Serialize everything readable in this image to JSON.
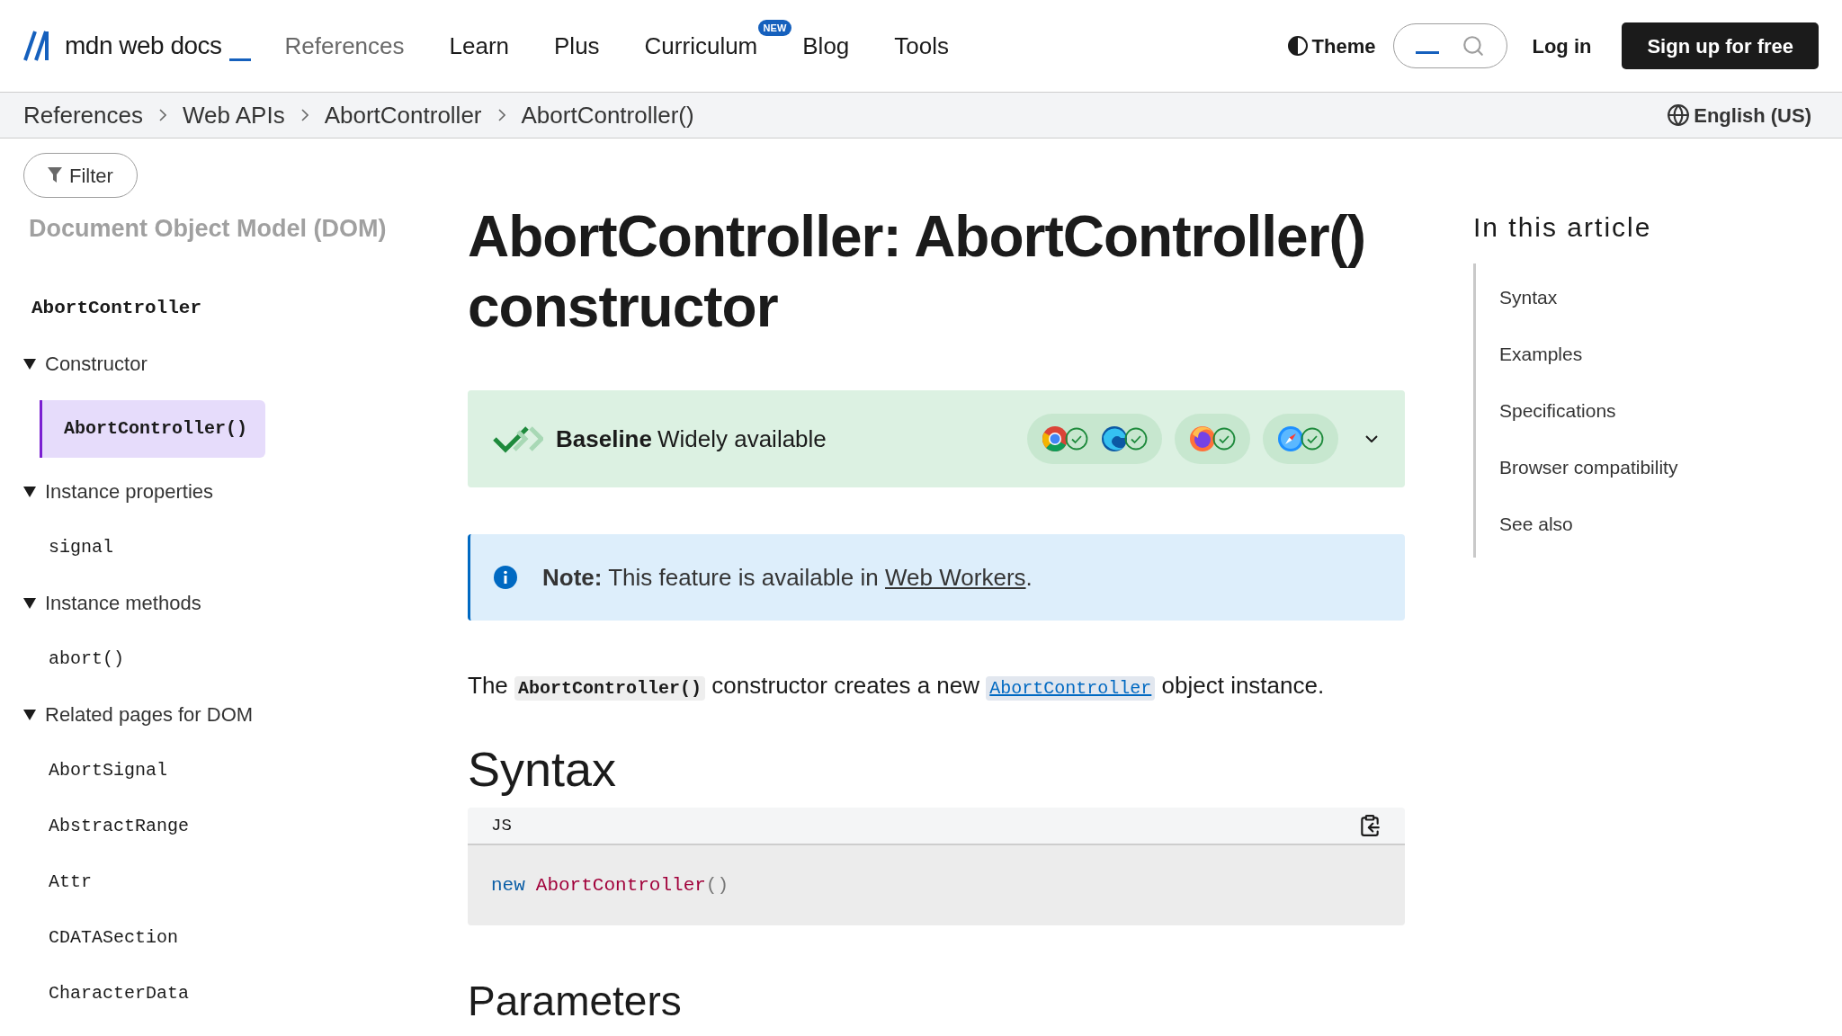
{
  "header": {
    "logo": "mdn web docs",
    "nav": [
      {
        "label": "References",
        "selected": true
      },
      {
        "label": "Learn",
        "selected": false
      },
      {
        "label": "Plus",
        "selected": false
      },
      {
        "label": "Curriculum",
        "selected": false,
        "badge": "NEW"
      },
      {
        "label": "Blog",
        "selected": false
      },
      {
        "label": "Tools",
        "selected": false
      }
    ],
    "theme": "Theme",
    "login": "Log in",
    "signup": "Sign up for free"
  },
  "breadcrumbs": [
    "References",
    "Web APIs",
    "AbortController",
    "AbortController()"
  ],
  "language": "English (US)",
  "sidebar": {
    "filter": "Filter",
    "section": "Document Object Model (DOM)",
    "items": [
      {
        "kind": "heading",
        "label": "AbortController",
        "selected": false
      },
      {
        "kind": "group",
        "label": "Constructor",
        "expanded": true,
        "children": [
          {
            "kind": "code",
            "label": "AbortController()",
            "selected": true
          }
        ]
      },
      {
        "kind": "group",
        "label": "Instance properties",
        "expanded": true,
        "children": [
          {
            "kind": "code",
            "label": "signal",
            "selected": false
          }
        ]
      },
      {
        "kind": "group",
        "label": "Instance methods",
        "expanded": true,
        "children": [
          {
            "kind": "code",
            "label": "abort()",
            "selected": false
          }
        ]
      },
      {
        "kind": "group",
        "label": "Related pages for DOM",
        "expanded": true,
        "children": [
          {
            "kind": "code",
            "label": "AbortSignal",
            "selected": false
          },
          {
            "kind": "code",
            "label": "AbstractRange",
            "selected": false
          },
          {
            "kind": "code",
            "label": "Attr",
            "selected": false
          },
          {
            "kind": "code",
            "label": "CDATASection",
            "selected": false
          },
          {
            "kind": "code",
            "label": "CharacterData",
            "selected": false
          }
        ]
      }
    ]
  },
  "article": {
    "title": "AbortController: AbortController() constructor",
    "baseline": {
      "label": "Baseline",
      "status": "Widely available",
      "expanded": false,
      "groups": [
        {
          "browsers": [
            {
              "kind": "chrome",
              "supported": true
            },
            {
              "kind": "edge",
              "supported": true
            }
          ]
        },
        {
          "browsers": [
            {
              "kind": "firefox",
              "supported": true
            }
          ]
        },
        {
          "browsers": [
            {
              "kind": "safari",
              "supported": true
            }
          ]
        }
      ]
    },
    "note": {
      "text": "**Note:** This feature is available in",
      "link": "Web Workers",
      "after": "."
    },
    "intro": {
      "before": "The",
      "code": "AbortController()",
      "middle": "constructor creates a new",
      "link": "AbortController",
      "after": "object instance."
    },
    "syntax_heading": "Syntax",
    "code": {
      "language": "JS",
      "tokens": [
        {
          "kind": "keyword",
          "text": "new"
        },
        {
          "kind": "name",
          "text": "AbortController"
        },
        {
          "kind": "punct",
          "text": "()"
        }
      ]
    },
    "parameters_heading": "Parameters"
  },
  "toc": {
    "title": "In this article",
    "items": [
      "Syntax",
      "Examples",
      "Specifications",
      "Browser compatibility",
      "See also"
    ]
  }
}
